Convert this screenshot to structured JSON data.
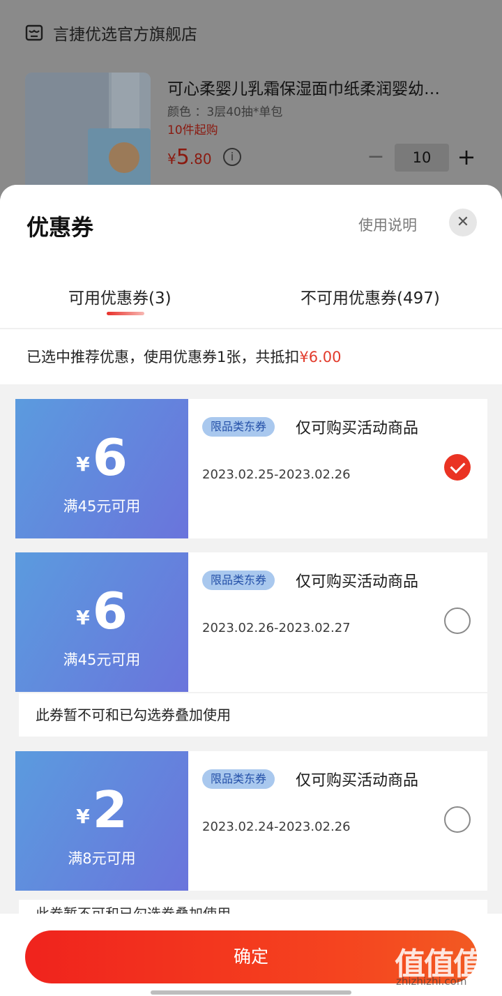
{
  "background": {
    "shop_name": "言捷优选官方旗舰店",
    "product": {
      "title": "可心柔婴儿乳霜保湿面巾纸柔润婴幼…",
      "spec": "颜色 ：3层40抽*单包",
      "min_purchase": "10件起购",
      "price_currency": "¥",
      "price_int": "5",
      "price_dec": ".80",
      "quantity": "10",
      "minus_label": "−",
      "plus_label": "+",
      "info_label": "i"
    }
  },
  "sheet": {
    "title": "优惠券",
    "help_label": "使用说明",
    "close_label": "✕",
    "tabs": [
      {
        "label": "可用优惠券(3)",
        "active": true
      },
      {
        "label": "不可用优惠券(497)",
        "active": false
      }
    ],
    "summary_text": "已选中推荐优惠，使用优惠券1张，共抵扣",
    "summary_amount": "¥6.00"
  },
  "coupons": [
    {
      "currency": "¥",
      "amount": "6",
      "condition": "满45元可用",
      "tag": "限品类东券",
      "description": "仅可购买活动商品",
      "date": "2023.02.25-2023.02.26",
      "selected": true
    },
    {
      "currency": "¥",
      "amount": "6",
      "condition": "满45元可用",
      "tag": "限品类东券",
      "description": "仅可购买活动商品",
      "date": "2023.02.26-2023.02.27",
      "selected": false,
      "note": "此券暂不可和已勾选券叠加使用"
    },
    {
      "currency": "¥",
      "amount": "2",
      "condition": "满8元可用",
      "tag": "限品类东券",
      "description": "仅可购买活动商品",
      "date": "2023.02.24-2023.02.26",
      "selected": false,
      "note": "此券暂不可和已勾选券叠加使用"
    }
  ],
  "footer": {
    "confirm_label": "确定"
  },
  "watermark": {
    "logo": "值值值",
    "site": "zhizhizhi.com"
  },
  "colors": {
    "accent_red": "#e23b2c",
    "coupon_blue_start": "#5b9bde",
    "coupon_blue_end": "#6a74dc"
  }
}
